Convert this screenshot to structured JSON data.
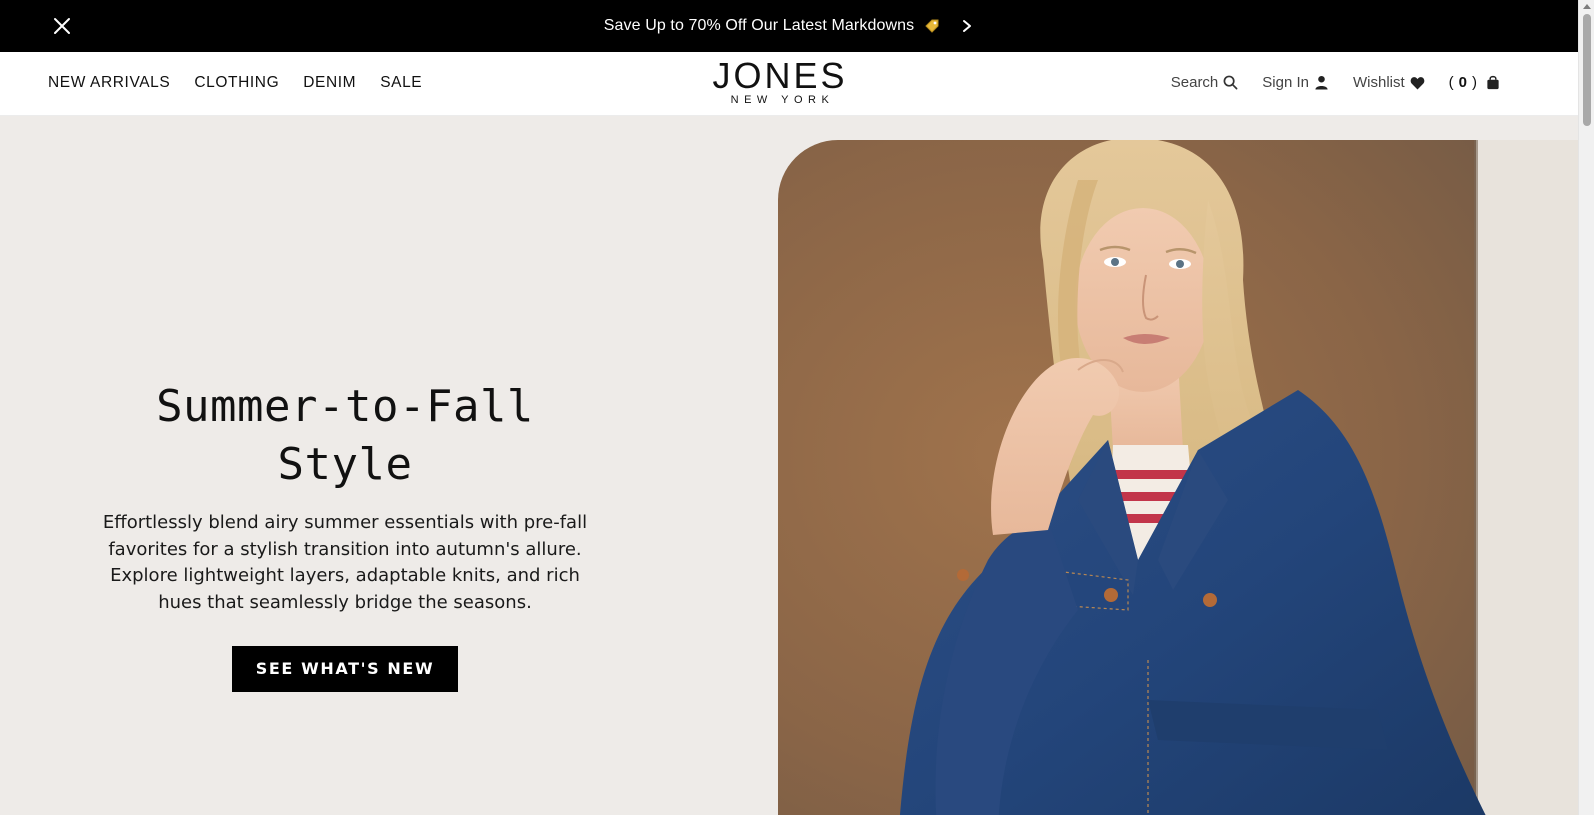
{
  "promo": {
    "text": "Save Up to 70% Off Our Latest Markdowns",
    "close_icon": "close-icon",
    "tag_icon": "price-tag-icon",
    "next_icon": "chevron-right-icon"
  },
  "nav": {
    "items": [
      {
        "label": "NEW ARRIVALS"
      },
      {
        "label": "CLOTHING"
      },
      {
        "label": "DENIM"
      },
      {
        "label": "SALE"
      }
    ]
  },
  "logo": {
    "main": "JONES",
    "sub": "NEW YORK"
  },
  "utilities": {
    "search_label": "Search",
    "signin_label": "Sign In",
    "wishlist_label": "Wishlist",
    "cart_open": "(",
    "cart_count": "0",
    "cart_close": ")"
  },
  "hero": {
    "title": "Summer-to-Fall Style",
    "body": "Effortlessly blend airy summer essentials with pre-fall favorites for a stylish transition into autumn's allure. Explore lightweight layers, adaptable knits, and rich hues that seamlessly bridge the seasons.",
    "cta_label": "SEE WHAT'S NEW"
  },
  "colors": {
    "promo_bg": "#000000",
    "hero_bg": "#eeebe8",
    "cta_bg": "#000000",
    "accent_tag": "#e8b93a"
  }
}
